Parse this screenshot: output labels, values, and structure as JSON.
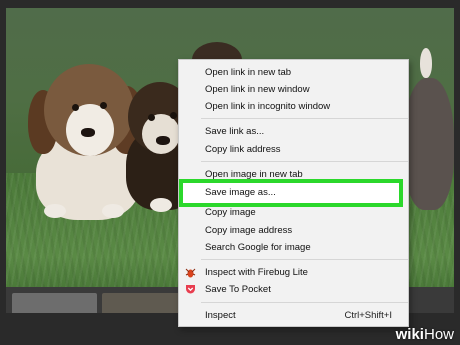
{
  "context_menu": {
    "items": [
      {
        "label": "Open link in new tab"
      },
      {
        "label": "Open link in new window"
      },
      {
        "label": "Open link in incognito window"
      },
      {
        "label": "Save link as..."
      },
      {
        "label": "Copy link address"
      },
      {
        "label": "Open image in new tab"
      },
      {
        "label": "Save image as..."
      },
      {
        "label": "Copy image"
      },
      {
        "label": "Copy image address"
      },
      {
        "label": "Search Google for image"
      },
      {
        "label": "Inspect with Firebug Lite",
        "icon": "firebug-icon"
      },
      {
        "label": "Save To Pocket",
        "icon": "pocket-icon"
      },
      {
        "label": "Inspect",
        "shortcut": "Ctrl+Shift+I"
      }
    ],
    "highlighted_item": "Save image as...",
    "highlight_color": "#2bd82b"
  },
  "watermark": {
    "wiki": "wiki",
    "how": "How"
  }
}
